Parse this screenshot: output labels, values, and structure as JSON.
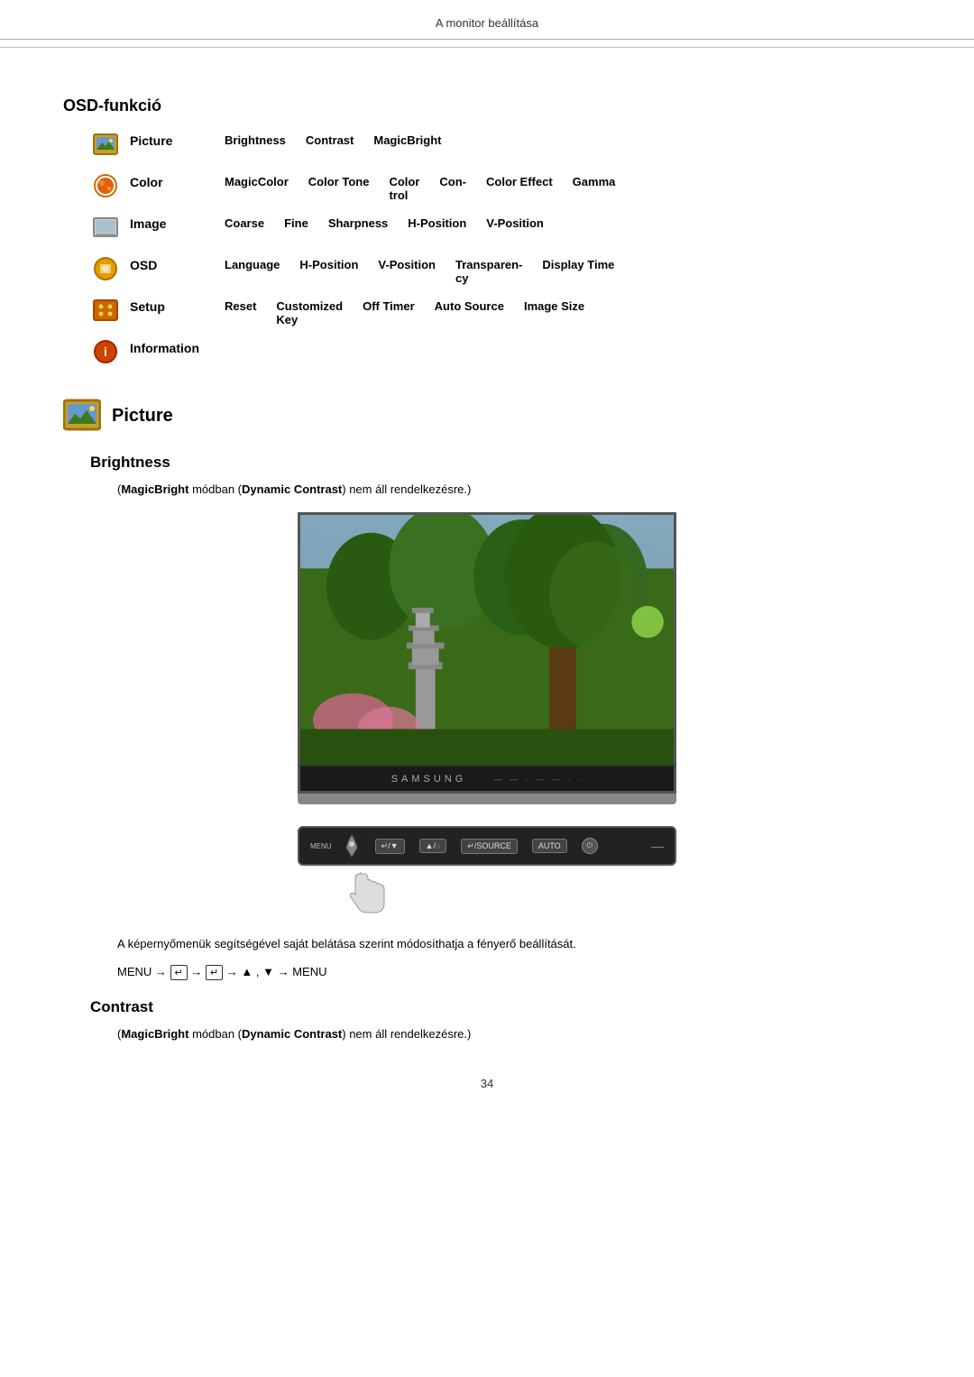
{
  "header": {
    "title": "A monitor beállítása"
  },
  "osd_section": {
    "title": "OSD-funkció",
    "rows": [
      {
        "id": "picture",
        "label": "Picture",
        "items": [
          "Brightness",
          "Contrast",
          "MagicBright"
        ]
      },
      {
        "id": "color",
        "label": "Color",
        "items": [
          "MagicColor",
          "Color Tone",
          "Color trol",
          "Con-",
          "Color Effect",
          "Gamma"
        ]
      },
      {
        "id": "image",
        "label": "Image",
        "items": [
          "Coarse",
          "Fine",
          "Sharpness",
          "H-Position",
          "V-Position"
        ]
      },
      {
        "id": "osd",
        "label": "OSD",
        "items": [
          "Language",
          "H-Position",
          "V-Position",
          "Transparen- cy",
          "Display Time"
        ]
      },
      {
        "id": "setup",
        "label": "Setup",
        "items": [
          "Reset",
          "Customized Key",
          "Off Timer",
          "Auto Source",
          "Image Size"
        ]
      },
      {
        "id": "information",
        "label": "Information",
        "items": []
      }
    ]
  },
  "picture_section": {
    "icon_label": "Picture",
    "title": "Picture"
  },
  "brightness_section": {
    "title": "Brightness",
    "note": "(MagicBright módban (Dynamic Contrast) nem áll rendelkezésre.)",
    "note_bold_parts": [
      "MagicBright",
      "Dynamic Contrast"
    ],
    "desc": "A képernyőmenük segítségével saját belátása szerint módosíthatja a fényerő beállítását.",
    "menu_nav": "MENU → ↵ → ↵ → ▲ , ▼ → MENU"
  },
  "contrast_section": {
    "title": "Contrast",
    "note": "(MagicBright módban (Dynamic Contrast) nem áll rendelkezésre.)"
  },
  "control_panel": {
    "menu_label": "MENU",
    "btn1": "↵/▼",
    "btn2": "▲/◌",
    "btn3": "↵/SOURCE",
    "btn4": "AUTO",
    "power_symbol": "⏻",
    "dash": "—"
  },
  "page_number": "34"
}
